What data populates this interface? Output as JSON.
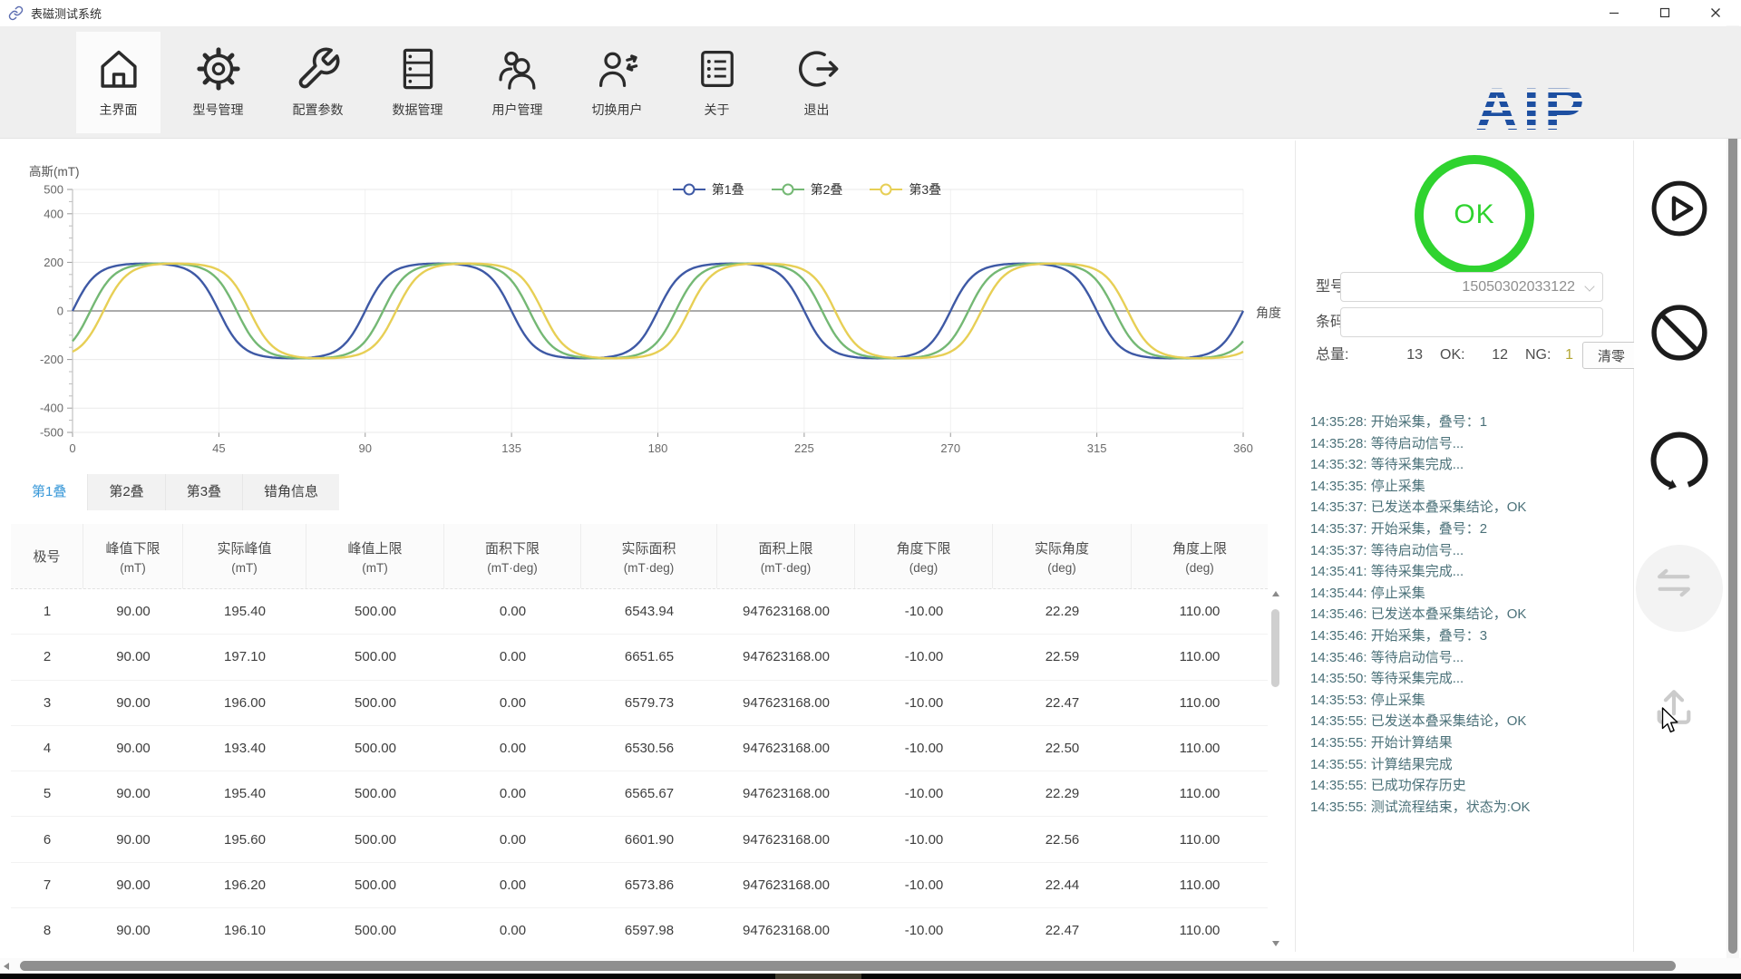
{
  "window": {
    "title": "表磁测试系统"
  },
  "toolbar": {
    "items": [
      {
        "label": "主界面",
        "icon": "home-icon",
        "active": true
      },
      {
        "label": "型号管理",
        "icon": "gear-icon",
        "active": false
      },
      {
        "label": "配置参数",
        "icon": "wrench-icon",
        "active": false
      },
      {
        "label": "数据管理",
        "icon": "database-icon",
        "active": false
      },
      {
        "label": "用户管理",
        "icon": "users-icon",
        "active": false
      },
      {
        "label": "切换用户",
        "icon": "switch-user-icon",
        "active": false
      },
      {
        "label": "关于",
        "icon": "about-icon",
        "active": false
      },
      {
        "label": "退出",
        "icon": "exit-icon",
        "active": false
      }
    ],
    "logo_text": "AIP",
    "logo_color": "#1d4fa1"
  },
  "chart_data": {
    "type": "line",
    "title": "",
    "ylabel": "高斯(mT)",
    "xlabel": "角度",
    "xlim": [
      0,
      360
    ],
    "ylim": [
      -500,
      500
    ],
    "x_ticks": [
      0,
      45,
      90,
      135,
      180,
      225,
      270,
      315,
      360
    ],
    "y_ticks": [
      500,
      400,
      200,
      0,
      -200,
      -400,
      -500
    ],
    "grid": true,
    "legend_position": "top-center",
    "clip_softness": 1.9,
    "series": [
      {
        "name": "第1叠",
        "color": "#3e59a5",
        "waveform": "clipped-sine",
        "amplitude": 195,
        "period_deg": 90,
        "phase_deg": 0
      },
      {
        "name": "第2叠",
        "color": "#74b874",
        "waveform": "clipped-sine",
        "amplitude": 195,
        "period_deg": 90,
        "phase_deg": 5.5
      },
      {
        "name": "第3叠",
        "color": "#e7cf55",
        "waveform": "clipped-sine",
        "amplitude": 195,
        "period_deg": 90,
        "phase_deg": 9.5
      }
    ]
  },
  "tabs": {
    "items": [
      "第1叠",
      "第2叠",
      "第3叠",
      "错角信息"
    ],
    "active_index": 0
  },
  "table": {
    "columns": [
      {
        "label": "极号",
        "unit": ""
      },
      {
        "label": "峰值下限",
        "unit": "(mT)"
      },
      {
        "label": "实际峰值",
        "unit": "(mT)"
      },
      {
        "label": "峰值上限",
        "unit": "(mT)"
      },
      {
        "label": "面积下限",
        "unit": "(mT·deg)"
      },
      {
        "label": "实际面积",
        "unit": "(mT·deg)"
      },
      {
        "label": "面积上限",
        "unit": "(mT·deg)"
      },
      {
        "label": "角度下限",
        "unit": "(deg)"
      },
      {
        "label": "实际角度",
        "unit": "(deg)"
      },
      {
        "label": "角度上限",
        "unit": "(deg)"
      }
    ],
    "rows": [
      [
        "1",
        "90.00",
        "195.40",
        "500.00",
        "0.00",
        "6543.94",
        "947623168.00",
        "-10.00",
        "22.29",
        "110.00"
      ],
      [
        "2",
        "90.00",
        "197.10",
        "500.00",
        "0.00",
        "6651.65",
        "947623168.00",
        "-10.00",
        "22.59",
        "110.00"
      ],
      [
        "3",
        "90.00",
        "196.00",
        "500.00",
        "0.00",
        "6579.73",
        "947623168.00",
        "-10.00",
        "22.47",
        "110.00"
      ],
      [
        "4",
        "90.00",
        "193.40",
        "500.00",
        "0.00",
        "6530.56",
        "947623168.00",
        "-10.00",
        "22.50",
        "110.00"
      ],
      [
        "5",
        "90.00",
        "195.40",
        "500.00",
        "0.00",
        "6565.67",
        "947623168.00",
        "-10.00",
        "22.29",
        "110.00"
      ],
      [
        "6",
        "90.00",
        "195.60",
        "500.00",
        "0.00",
        "6601.90",
        "947623168.00",
        "-10.00",
        "22.56",
        "110.00"
      ],
      [
        "7",
        "90.00",
        "196.20",
        "500.00",
        "0.00",
        "6573.86",
        "947623168.00",
        "-10.00",
        "22.44",
        "110.00"
      ],
      [
        "8",
        "90.00",
        "196.10",
        "500.00",
        "0.00",
        "6597.98",
        "947623168.00",
        "-10.00",
        "22.47",
        "110.00"
      ]
    ]
  },
  "status_panel": {
    "result_text": "OK",
    "result_color": "#2fd32f",
    "model_label": "型号:",
    "model_value": "15050302033122",
    "barcode_label": "条码:",
    "barcode_value": "",
    "total_label": "总量:",
    "total_value": "13",
    "ok_label": "OK:",
    "ok_value": "12",
    "ng_label": "NG:",
    "ng_value": "1",
    "clear_button_label": "清零",
    "log": [
      "14:35:28: 开始采集，叠号：1",
      "14:35:28: 等待启动信号...",
      "14:35:32: 等待采集完成...",
      "14:35:35: 停止采集",
      "14:35:37: 已发送本叠采集结论，OK",
      "14:35:37: 开始采集，叠号：2",
      "14:35:37: 等待启动信号...",
      "14:35:41: 等待采集完成...",
      "14:35:44: 停止采集",
      "14:35:46: 已发送本叠采集结论，OK",
      "14:35:46: 开始采集，叠号：3",
      "14:35:46: 等待启动信号...",
      "14:35:50: 等待采集完成...",
      "14:35:53: 停止采集",
      "14:35:55: 已发送本叠采集结论，OK",
      "14:35:55: 开始计算结果",
      "14:35:55: 计算结果完成",
      "14:35:55: 已成功保存历史",
      "14:35:55: 测试流程结束，状态为:OK"
    ]
  },
  "side_buttons": [
    {
      "name": "start-button",
      "icon": "play-icon",
      "enabled": true
    },
    {
      "name": "stop-button",
      "icon": "ban-icon",
      "enabled": true
    },
    {
      "name": "reset-button",
      "icon": "rotate-icon",
      "enabled": true
    },
    {
      "name": "transfer-button",
      "icon": "swap-icon",
      "enabled": false
    },
    {
      "name": "upload-button",
      "icon": "upload-icon",
      "enabled": false
    }
  ]
}
